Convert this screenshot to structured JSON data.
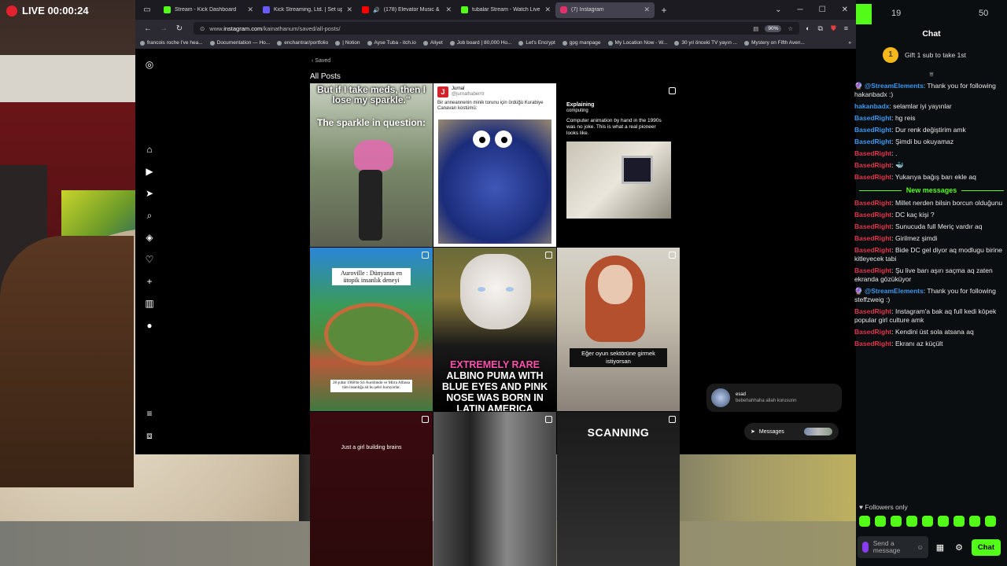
{
  "live": {
    "label": "LIVE 00:00:24"
  },
  "browser": {
    "tabs": [
      {
        "title": "Stream - Kick Dashboard",
        "color": "#53fc18"
      },
      {
        "title": "Kick Streaming, Ltd. | Set up pa",
        "color": "#6a5af9"
      },
      {
        "title": "(178) Elevator Music & Ele",
        "color": "#ff0000"
      },
      {
        "title": "tubalar Stream - Watch Live on",
        "color": "#53fc18"
      },
      {
        "title": "(7) Instagram",
        "color": "#e1306c"
      }
    ],
    "url_prefix": "www.",
    "url_domain": "instagram.com",
    "url_path": "/kainathanum/saved/all-posts/",
    "zoom": "90%",
    "bookmarks": [
      "francois roche I've hea...",
      "Documentation — Ho...",
      "enchantrar/portfolio",
      "| Notion",
      "Ayse Tuba - itch.io",
      "Aliyet",
      "Job board | 80,000 Ho...",
      "Let's Encrypt",
      "gpg manpage",
      "My Location Now - W...",
      "30 yıl önceki TV yayın ...",
      "Mystery on Fifth Aven..."
    ]
  },
  "instagram": {
    "back_label": "Saved",
    "section_title": "All Posts",
    "posts": {
      "p1_line1": "But if I take meds, then I",
      "p1_line2": "lose my sparkle.\"",
      "p1_line3": "The sparkle in question:",
      "p2_name": "Jurnal",
      "p2_handle": "@jurnalhaberrtr",
      "p2_text": "Bir anneannenin minik torunu için ördüğü Kurabiye Canavarı kostümü:",
      "p3_brand": "Explaining",
      "p3_brand_sub": "computing",
      "p3_text": "Computer animation by hand in the 1990s was no joke. This is what a real pioneer looks like.",
      "p4_title": "Auroville : Dünyanın en ütopik insanlık deneyi",
      "p4_caption": "28 şubat 1968'de Sri Aurobindo ve Mirra Alfassa tüm insanlığa ait bu şehri kuruyorlar.",
      "p5_line_pink": "EXTREMELY RARE",
      "p5_line_rest": "ALBINO PUMA WITH BLUE EYES AND PINK NOSE WAS BORN IN LATIN AMERICA",
      "p6_caption": "Eğer oyun sektörüne girmek istiyorsan",
      "p7_caption": "Just a girl building brains",
      "p9_caption": "SCANNING"
    },
    "message_popup": {
      "name": "esad",
      "text": "bebehahhaha allah korusunn"
    },
    "messages_label": "Messages",
    "messages_badge": "1"
  },
  "chat": {
    "count_left": "19",
    "count_right": "50",
    "title": "Chat",
    "gift_num": "1",
    "gift_text": "Gift 1 sub to take 1st",
    "new_messages_label": "New messages",
    "messages_before": [
      {
        "user": "@StreamElements",
        "text": ": Thank you for following hakanbadx :)",
        "color": "#3b97f0",
        "prefix": "🔮 "
      },
      {
        "user": "hakanbadx",
        "text": ": selamlar iyi yayınlar",
        "color": "#3b97f0",
        "prefix": ""
      },
      {
        "user": "BasedRight",
        "text": ": hg reis",
        "color": "#3b97f0",
        "prefix": ""
      },
      {
        "user": "BasedRight",
        "text": ": Dur renk değiştirim amk",
        "color": "#3b97f0",
        "prefix": ""
      },
      {
        "user": "BasedRight",
        "text": ": Şimdi bu okuyamaz",
        "color": "#3b97f0",
        "prefix": ""
      },
      {
        "user": "BasedRight",
        "text": ": .",
        "color": "#e0344b",
        "prefix": ""
      },
      {
        "user": "BasedRight",
        "text": ": 🐳",
        "color": "#e0344b",
        "prefix": ""
      },
      {
        "user": "BasedRight",
        "text": ": Yukarıya bağış barı ekle aq",
        "color": "#e0344b",
        "prefix": ""
      }
    ],
    "messages_after": [
      {
        "user": "BasedRight",
        "text": ": Millet nerden bilsin borcun olduğunu",
        "color": "#e0344b",
        "prefix": ""
      },
      {
        "user": "BasedRight",
        "text": ": DC kaç kişi ?",
        "color": "#e0344b",
        "prefix": ""
      },
      {
        "user": "BasedRight",
        "text": ": Sunucuda full Meriç vardır aq",
        "color": "#e0344b",
        "prefix": ""
      },
      {
        "user": "BasedRight",
        "text": ": Girilmez şimdi",
        "color": "#e0344b",
        "prefix": ""
      },
      {
        "user": "BasedRight",
        "text": ": Bide DC gel diyor aq modlugu birine kitleyecek tabi",
        "color": "#e0344b",
        "prefix": ""
      },
      {
        "user": "BasedRight",
        "text": ": Şu live barı aşırı saçma aq zaten ekranda gözüküyor",
        "color": "#e0344b",
        "prefix": ""
      },
      {
        "user": "@StreamElements",
        "text": ": Thank you for following steffzweig :)",
        "color": "#3b97f0",
        "prefix": "🔮 "
      },
      {
        "user": "BasedRight",
        "text": ": Instagram'a bak aq full kedi köpek popular girl culture amk",
        "color": "#e0344b",
        "prefix": ""
      },
      {
        "user": "BasedRight",
        "text": ": Kendini üst sola atsana aq",
        "color": "#e0344b",
        "prefix": ""
      },
      {
        "user": "BasedRight",
        "text": ": Ekranı az küçült",
        "color": "#e0344b",
        "prefix": ""
      }
    ],
    "followers_only": "Followers only",
    "input_placeholder": "Send a message",
    "send_label": "Chat"
  }
}
